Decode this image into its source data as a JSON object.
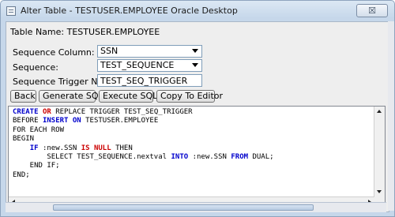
{
  "window": {
    "title": "Alter Table - TESTUSER.EMPLOYEE Oracle Desktop",
    "close_label": "☒"
  },
  "form": {
    "table_name_label": "Table Name: TESTUSER.EMPLOYEE",
    "sequence_column_label": "Sequence Column:",
    "sequence_column_value": "SSN",
    "sequence_label": "Sequence:",
    "sequence_value": "TEST_SEQUENCE",
    "trigger_name_label": "Sequence Trigger Name:",
    "trigger_name_value": "TEST_SEQ_TRIGGER"
  },
  "buttons": {
    "back": "Back",
    "generate_sql": "Generate SQL",
    "execute_sql": "Execute SQL",
    "copy_to_editor": "Copy To Editor"
  },
  "sql": {
    "l1_create": "CREATE",
    "l1_or": "OR",
    "l1_rest": " REPLACE TRIGGER TEST_SEQ_TRIGGER",
    "l2_before": "BEFORE ",
    "l2_insert": "INSERT",
    "l2_sp": " ",
    "l2_on": "ON",
    "l2_rest": " TESTUSER.EMPLOYEE",
    "l3": "FOR EACH ROW",
    "l4": "BEGIN",
    "l5_indent": "    ",
    "l5_if": "IF",
    "l5_mid": " :new.SSN ",
    "l5_isnull": "IS NULL",
    "l5_then": " THEN",
    "l6_indent": "        SELECT TEST_SEQUENCE.nextval ",
    "l6_into": "INTO",
    "l6_mid": " :new.SSN ",
    "l6_from": "FROM",
    "l6_rest": " DUAL;",
    "l7": "    END IF;",
    "l8": "END;"
  }
}
